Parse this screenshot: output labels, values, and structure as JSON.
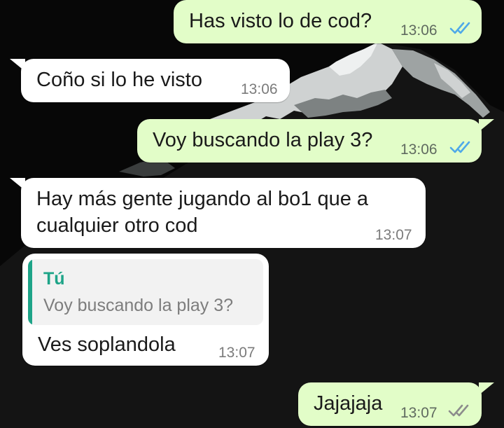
{
  "chat": {
    "messages": [
      {
        "direction": "outgoing",
        "text": "Has visto lo de cod?",
        "time": "13:06",
        "status": "read"
      },
      {
        "direction": "incoming",
        "text": "Coño si lo he visto",
        "time": "13:06"
      },
      {
        "direction": "outgoing",
        "text": "Voy buscando la play 3?",
        "time": "13:06",
        "status": "read"
      },
      {
        "direction": "incoming",
        "text_lines": [
          "Hay más gente jugando al bo1 que a",
          "cualquier otro cod"
        ],
        "time": "13:07"
      },
      {
        "direction": "incoming",
        "reply_to": {
          "author": "Tú",
          "text": "Voy buscando la play 3?"
        },
        "text": "Ves soplandola",
        "time": "13:07"
      },
      {
        "direction": "outgoing",
        "text": "Jajajaja",
        "time": "13:07",
        "status": "delivered"
      }
    ]
  },
  "colors": {
    "outgoing_bubble": "#e2fdc8",
    "incoming_bubble": "#ffffff",
    "read_ticks": "#4fa9e8",
    "delivered_ticks": "#8c8c8c",
    "reply_accent": "#1ea488"
  },
  "icons": {
    "read": "double-check-icon",
    "delivered": "double-check-icon"
  }
}
